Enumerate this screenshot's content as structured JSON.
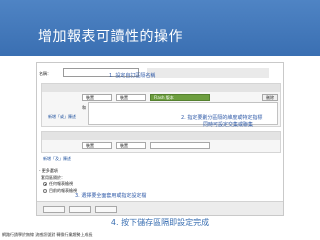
{
  "slide": {
    "title": "增加報表可讀性的操作",
    "caption": "4. 按下儲存區隔即設定完成",
    "bottom_note": "網路行銷學於無線 流感訊號對 轉換行業趨勢上成長"
  },
  "form": {
    "name_label": "名稱：",
    "name_value": "",
    "row1": {
      "select1": "裝置",
      "select2": "裝置",
      "select3": "Flash 版本",
      "button": "刪除"
    },
    "and_label": "和",
    "add_condition": "新增「或」陳述",
    "row2": {
      "select1": "裝置",
      "select2": "裝置",
      "select3": "",
      "button": ""
    },
    "add_and": "新增「及」陳述",
    "advanced_heading": "- 更多選項",
    "radio_heading": "套用區隔於：",
    "radio_options": [
      {
        "label": "任何報表檢視",
        "checked": true
      },
      {
        "label": "目前的報表檢視",
        "checked": false
      }
    ]
  },
  "annotations": {
    "a1": "1. 設定自訂區隔名稱",
    "a2_line1": "2. 指定要劃分區隔的維度或特定指標",
    "a2_line2": "同時可設定交集或聯集",
    "a3": "3. 選擇要全面套用或指定設定檔"
  }
}
